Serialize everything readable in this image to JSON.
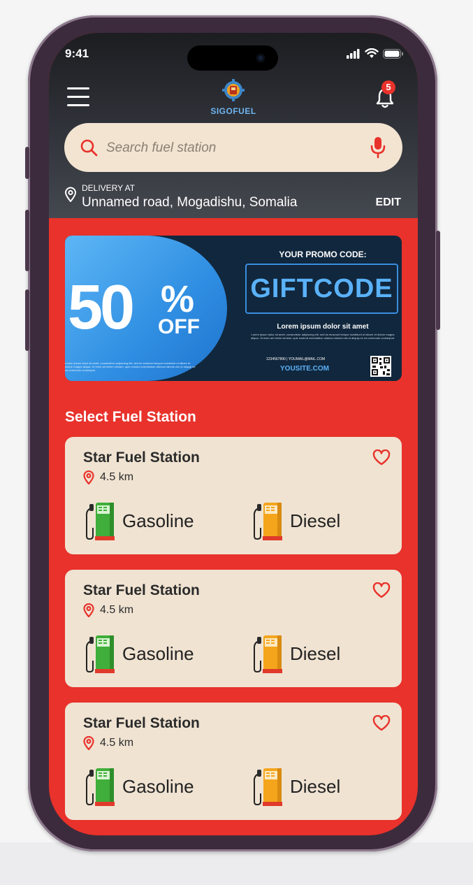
{
  "status_bar": {
    "time": "9:41"
  },
  "header": {
    "brand": "SIGOFUEL",
    "notification_count": "5"
  },
  "search": {
    "placeholder": "Search fuel station"
  },
  "delivery": {
    "label": "DELIVERY AT",
    "address": "Unnamed road, Mogadishu, Somalia",
    "edit_label": "EDIT"
  },
  "promo": {
    "big_number": "50",
    "percent": "%",
    "off": "OFF",
    "heading": "YOUR PROMO CODE:",
    "code": "GIFTCODE",
    "lorem_title": "Lorem ipsum dolor sit amet",
    "fine_print": "Lorem ipsum dolor sit amet, consectetur adipiscing elit, sed do eiusmod tempor incididunt ut labore et dolore magna aliqua. Ut enim ad minim veniam, quis nostrud exercitation ullamco laboris nisi ut aliquip ex ea commodo consequat.",
    "fine_print_left": "Lorem ipsum dolor sit amet, consectetur adipiscing elit, sed do eiusmod tempor incididunt ut labore et dolore magna aliqua. Ut enim ad minim veniam, quis nostrud exercitation ullamco laboris nisi ut aliquip ex ea commodo consequat.",
    "phone": "1234567890",
    "email": "YOUMAIL@MAIL.COM",
    "site": "YOUSITE.COM"
  },
  "section_title": "Select Fuel Station",
  "stations": [
    {
      "name": "Star Fuel Station",
      "distance": "4.5 km",
      "fuel_1": "Gasoline",
      "fuel_2": "Diesel"
    },
    {
      "name": "Star Fuel Station",
      "distance": "4.5 km",
      "fuel_1": "Gasoline",
      "fuel_2": "Diesel"
    },
    {
      "name": "Star Fuel Station",
      "distance": "4.5 km",
      "fuel_1": "Gasoline",
      "fuel_2": "Diesel"
    }
  ],
  "colors": {
    "accent_red": "#e8322b",
    "search_bg": "#f3e4d2",
    "card_bg": "#f0e3d2",
    "promo_blue": "#2f8ee2",
    "promo_dark": "#11273d",
    "gasoline_green": "#3fae3a",
    "diesel_orange": "#f4a51c"
  },
  "icons": [
    "menu-icon",
    "logo-icon",
    "bell-icon",
    "search-icon",
    "mic-icon",
    "location-pin-icon",
    "heart-icon",
    "gas-pump-green-icon",
    "gas-pump-orange-icon",
    "signal-icon",
    "wifi-icon",
    "battery-icon",
    "qr-code-icon"
  ]
}
